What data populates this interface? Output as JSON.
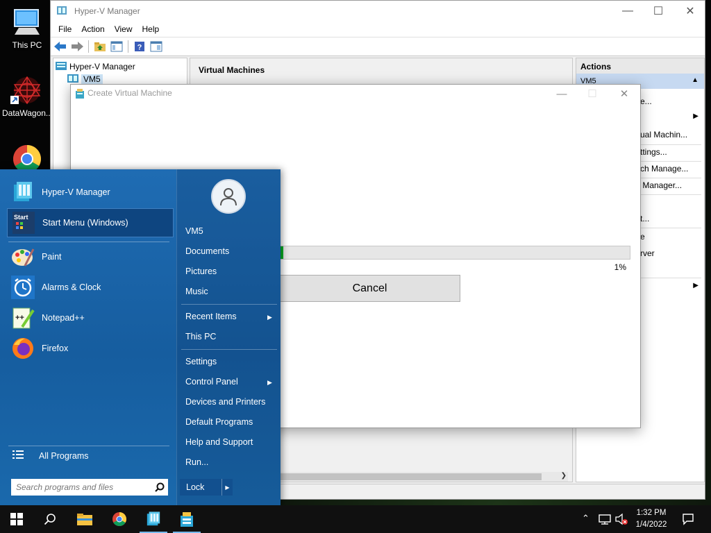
{
  "desktop": {
    "icons": [
      {
        "label": "This PC",
        "icon": "computer-icon"
      },
      {
        "label": "DataWagon...",
        "icon": "datawagon-icon"
      },
      {
        "label": "",
        "icon": "chrome-icon"
      }
    ]
  },
  "hyperv": {
    "title": "Hyper-V Manager",
    "menu": [
      "File",
      "Action",
      "View",
      "Help"
    ],
    "tree": {
      "root": "Hyper-V Manager",
      "child": "VM5"
    },
    "center_header": "Virtual Machines",
    "actions_header": "Actions",
    "actions_sub": "VM5",
    "actions_items": [
      "...e...",
      "...ual Machin...",
      "...ttings...",
      "...ch Manage...",
      "... Manager...",
      "...t...",
      "...e",
      "...rver"
    ]
  },
  "dialog": {
    "title": "Create Virtual Machine",
    "progress_pct": 1,
    "progress_label": "1%",
    "cancel_label": "Cancel"
  },
  "start_menu": {
    "pinned": [
      {
        "label": "Hyper-V Manager",
        "icon": "hyperv-icon"
      },
      {
        "label": "Start Menu (Windows)",
        "icon": "start-menu-icon",
        "highlighted": true
      }
    ],
    "recent": [
      {
        "label": "Paint",
        "icon": "paint-icon"
      },
      {
        "label": "Alarms & Clock",
        "icon": "alarm-clock-icon"
      },
      {
        "label": "Notepad++",
        "icon": "notepadpp-icon"
      },
      {
        "label": "Firefox",
        "icon": "firefox-icon"
      }
    ],
    "all_programs": "All Programs",
    "search_placeholder": "Search programs and files",
    "right_items": {
      "user": "VM5",
      "documents": "Documents",
      "pictures": "Pictures",
      "music": "Music",
      "recent_items": "Recent Items",
      "this_pc": "This PC",
      "settings": "Settings",
      "control_panel": "Control Panel",
      "devices": "Devices and Printers",
      "default_programs": "Default Programs",
      "help": "Help and Support",
      "run": "Run..."
    },
    "lock_label": "Lock"
  },
  "taskbar": {
    "time": "1:32 PM",
    "date": "1/4/2022"
  },
  "colors": {
    "start_blue": "#1f6cb3",
    "highlight": "#0e4580",
    "progress_green": "#06b025",
    "taskbar": "#101010"
  }
}
